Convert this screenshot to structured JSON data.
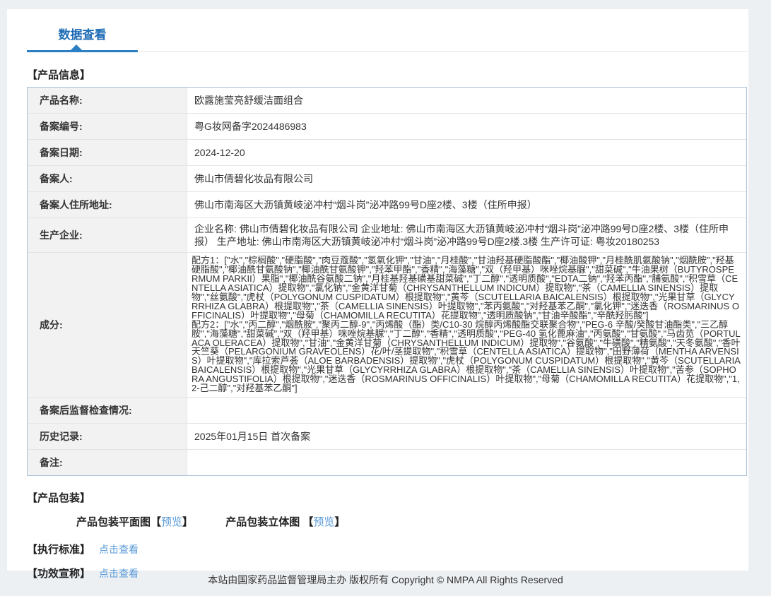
{
  "tab": {
    "label": "数据查看"
  },
  "product_info": {
    "section_title": "【产品信息】",
    "rows": [
      {
        "label": "产品名称:",
        "value": "欧露施莹亮舒缓洁面组合"
      },
      {
        "label": "备案编号:",
        "value": "粤G妆网备字2024486983"
      },
      {
        "label": "备案日期:",
        "value": "2024-12-20"
      },
      {
        "label": "备案人:",
        "value": "佛山市倩碧化妆品有限公司"
      },
      {
        "label": "备案人住所地址:",
        "value": "佛山市南海区大沥镇黄岐泌冲村“烟斗岗”泌冲路99号D座2楼、3楼（住所申报）"
      },
      {
        "label": "生产企业:",
        "value": "企业名称: 佛山市倩碧化妆品有限公司 企业地址: 佛山市南海区大沥镇黄岐泌冲村“烟斗岗”泌冲路99号D座2楼、3楼（住所申报） 生产地址: 佛山市南海区大沥镇黄岐泌冲村“烟斗岗”泌冲路99号D座2楼.3楼 生产许可证: 粤妆20180253"
      },
      {
        "label": "成分:",
        "value": "配方1：[\"水\",\"棕榈酸\",\"硬脂酸\",\"肉豆蔻酸\",\"氢氧化钾\",\"甘油\",\"月桂酸\",\"甘油羟基硬脂酸酯\",\"椰油酸钾\",\"月桂酰肌氨酸钠\",\"烟酰胺\",\"羟基硬脂酸\",\"椰油酰甘氨酸钠\",\"椰油酰甘氨酸钾\",\"羟苯甲酯\",\"香精\",\"海藻糖\",\"双（羟甲基）咪唑烷基脲\",\"甜菜碱\",\"牛油果树（BUTYROSPERMUM PARKII）果脂\",\"椰油酰谷氨酸二钠\",\"月桂基羟基磺基甜菜碱\",\"丁二醇\",\"透明质酸\",\"EDTA二钠\",\"羟苯丙酯\",\"脯氨酸\",\"积雪草（CENTELLA ASIATICA）提取物\",\"氯化钠\",\"金黄洋甘菊（CHRYSANTHELLUM INDICUM）提取物\",\"茶（CAMELLIA SINENSIS）提取物\",\"丝氨酸\",\"虎杖（POLYGONUM CUSPIDATUM）根提取物\",\"黄芩（SCUTELLARIA BAICALENSIS）根提取物\",\"光果甘草（GLYCYRRHIZA GLABRA）根提取物\",\"茶（CAMELLIA SINENSIS）叶提取物\",\"苯丙氨酸\",\"对羟基苯乙酮\",\"氯化钾\",\"迷迭香（ROSMARINUS OFFICINALIS）叶提取物\",\"母菊（CHAMOMILLA RECUTITA）花提取物\",\"透明质酸钠\",\"甘油辛酸酯\",\"辛酰羟肟酸\"]\n配方2：[\"水\",\"丙二醇\",\"烟酰胺\",\"聚丙二醇-9\",\"丙烯酸（酯）类/C10-30 烷醇丙烯酸酯交联聚合物\",\"PEG-6 辛酸/癸酸甘油酯类\",\"三乙醇胺\",\"海藻糖\",\"甜菜碱\",\"双（羟甲基）咪唑烷基脲\",\"丁二醇\",\"香精\",\"透明质酸\",\"PEG-40 氢化蓖麻油\",\"丙氨酸\",\"甘氨酸\",\"马齿苋（PORTULACA OLERACEA）提取物\",\"甘油\",\"金黄洋甘菊（CHRYSANTHELLUM INDICUM）提取物\",\"谷氨酸\",\"牛磺酸\",\"精氨酸\",\"天冬氨酸\",\"香叶天竺葵（PELARGONIUM GRAVEOLENS）花/叶/茎提取物\",\"积雪草（CENTELLA ASIATICA）提取物\",\"田野薄荷（MENTHA ARVENSIS）叶提取物\",\"库拉索芦荟（ALOE BARBADENSIS）提取物\",\"虎杖（POLYGONUM CUSPIDATUM）根提取物\",\"黄芩（SCUTELLARIA BAICALENSIS）根提取物\",\"光果甘草（GLYCYRRHIZA GLABRA）根提取物\",\"茶（CAMELLIA SINENSIS）叶提取物\",\"苦参（SOPHORA ANGUSTIFOLIA）根提取物\",\"迷迭香（ROSMARINUS OFFICINALIS）叶提取物\",\"母菊（CHAMOMILLA RECUTITA）花提取物\",\"1,2-己二醇\",\"对羟基苯乙酮\"]"
      },
      {
        "label": "备案后监督检查情况:",
        "value": ""
      },
      {
        "label": "历史记录:",
        "value": "2025年01月15日 首次备案"
      },
      {
        "label": "备注:",
        "value": ""
      }
    ]
  },
  "packaging": {
    "section_title": "【产品包装】",
    "items": [
      {
        "label": "产品包装平面图",
        "bracket_open": "【",
        "link_label": "预览",
        "bracket_close": "】"
      },
      {
        "label": "产品包装立体图 ",
        "bracket_open": "【",
        "link_label": "预览",
        "bracket_close": "】"
      }
    ]
  },
  "standard": {
    "title": "【执行标准】",
    "link_label": "点击查看"
  },
  "efficacy": {
    "title": "【功效宣称】",
    "link_label": "点击查看"
  },
  "footer": {
    "text": "本站由国家药品监督管理局主办 版权所有 Copyright © NMPA All Rights Reserved"
  },
  "colors": {
    "accent_blue": "#1e6cb5",
    "underline_blue": "#2b7fc2",
    "link_blue": "#5a9bd8",
    "label_bg": "#f2f2f2",
    "table_border": "#aac2d8",
    "page_bg": "#edf0f3"
  }
}
